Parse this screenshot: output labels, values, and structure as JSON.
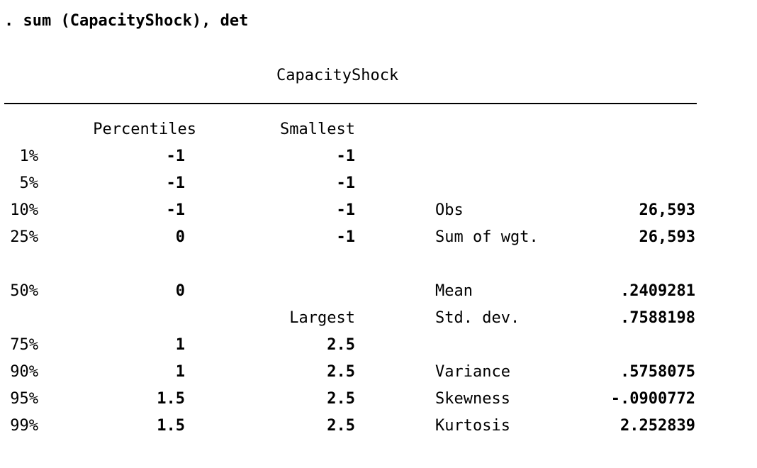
{
  "command": ". sum (CapacityShock), det",
  "variable": "CapacityShock",
  "headers": {
    "percentiles": "Percentiles",
    "smallest": "Smallest",
    "largest": "Largest"
  },
  "lower_rows": [
    {
      "pct": "1%",
      "percentile": "-1",
      "smallest": "-1",
      "stat_label": "",
      "stat_value": ""
    },
    {
      "pct": "5%",
      "percentile": "-1",
      "smallest": "-1",
      "stat_label": "",
      "stat_value": ""
    },
    {
      "pct": "10%",
      "percentile": "-1",
      "smallest": "-1",
      "stat_label": "Obs",
      "stat_value": "26,593"
    },
    {
      "pct": "25%",
      "percentile": "0",
      "smallest": "-1",
      "stat_label": "Sum of wgt.",
      "stat_value": "26,593"
    }
  ],
  "median_row": {
    "pct": "50%",
    "percentile": "0",
    "stat_label": "Mean",
    "stat_value": ".2409281"
  },
  "largest_header_stat": {
    "stat_label": "Std. dev.",
    "stat_value": ".7588198"
  },
  "upper_rows": [
    {
      "pct": "75%",
      "percentile": "1",
      "largest": "2.5",
      "stat_label": "",
      "stat_value": ""
    },
    {
      "pct": "90%",
      "percentile": "1",
      "largest": "2.5",
      "stat_label": "Variance",
      "stat_value": ".5758075"
    },
    {
      "pct": "95%",
      "percentile": "1.5",
      "largest": "2.5",
      "stat_label": "Skewness",
      "stat_value": "-.0900772"
    },
    {
      "pct": "99%",
      "percentile": "1.5",
      "largest": "2.5",
      "stat_label": "Kurtosis",
      "stat_value": "2.252839"
    }
  ]
}
